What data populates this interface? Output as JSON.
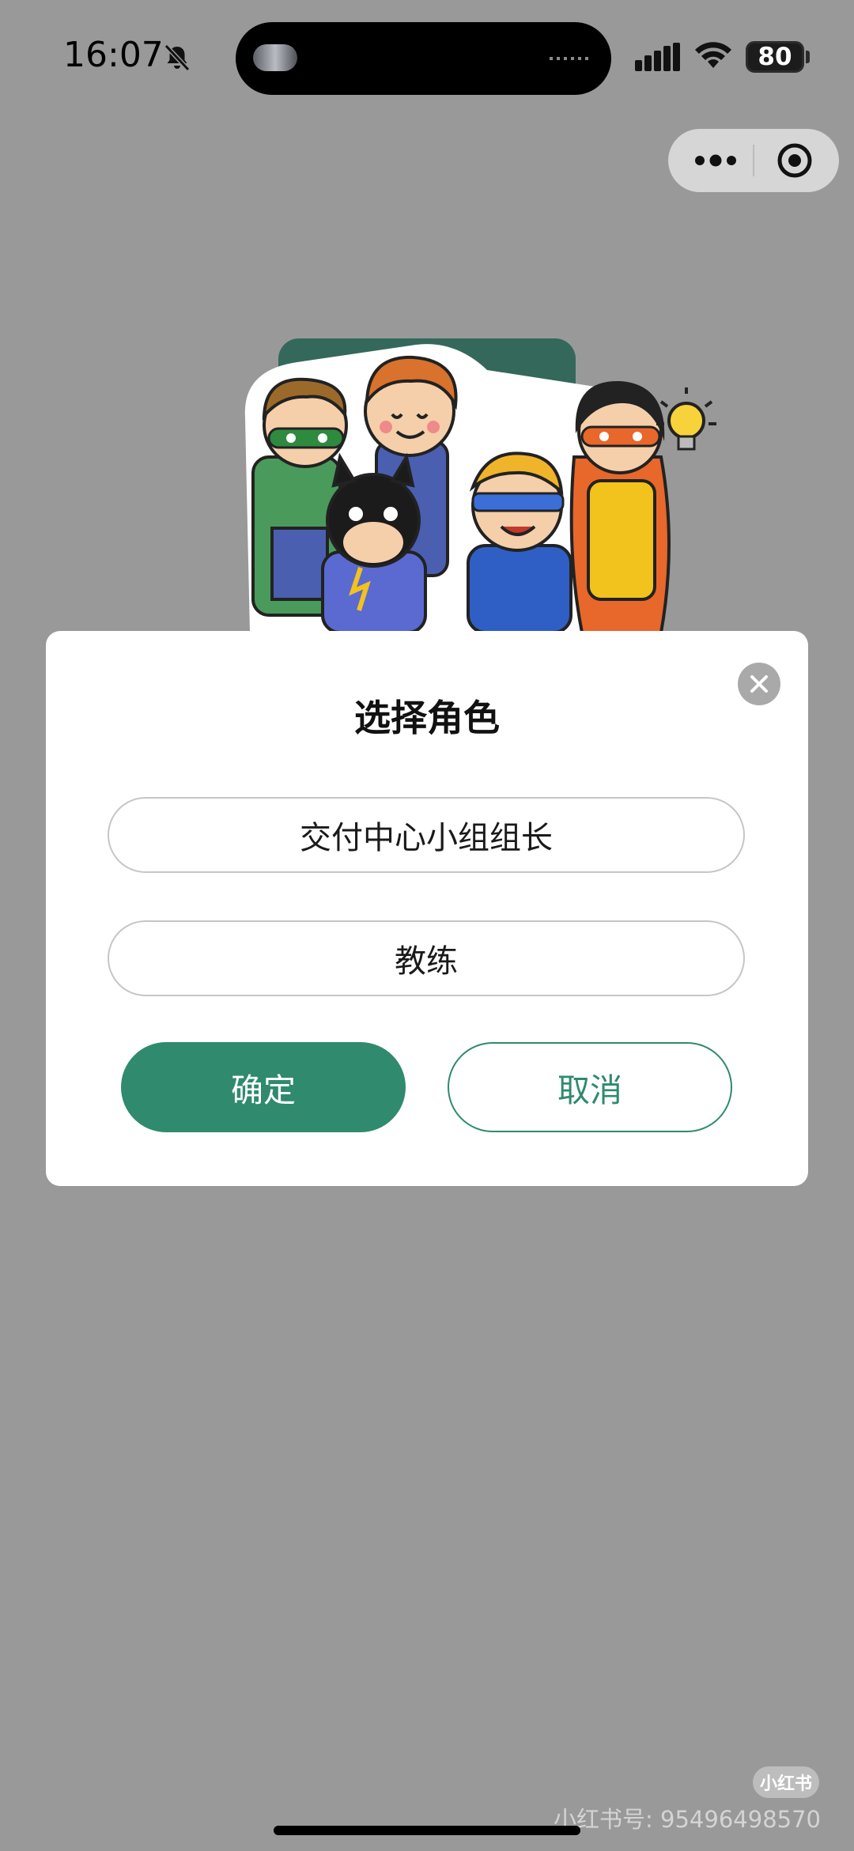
{
  "status_bar": {
    "time": "16:07",
    "battery": "80",
    "icons": [
      "bell-muted-icon",
      "cellular-signal-icon",
      "wifi-icon",
      "battery-icon"
    ]
  },
  "capsule": {
    "icons": [
      "more-dots-icon",
      "close-target-icon"
    ]
  },
  "dialog": {
    "title": "选择角色",
    "options": [
      {
        "label": "交付中心小组组长"
      },
      {
        "label": "教练"
      }
    ],
    "confirm_label": "确定",
    "cancel_label": "取消",
    "close_icon": "close-icon"
  },
  "colors": {
    "overlay": "#999999",
    "accent": "#2f8a6e",
    "dialog_bg": "#ffffff"
  },
  "watermark": {
    "badge": "小红书",
    "text": "小红书号: 95496498570"
  }
}
